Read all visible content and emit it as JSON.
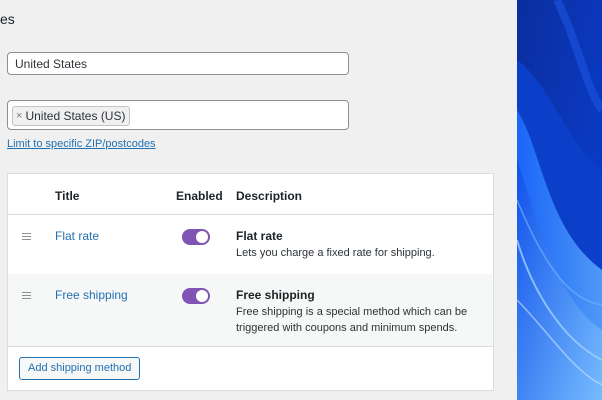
{
  "header": {
    "title_fragment": "es"
  },
  "zone": {
    "name_value": "United States",
    "regions": [
      {
        "label": "United States (US)",
        "remove_glyph": "×"
      }
    ],
    "zip_link": "Limit to specific ZIP/postcodes"
  },
  "methods_table": {
    "columns": {
      "title": "Title",
      "enabled": "Enabled",
      "description": "Description"
    },
    "rows": [
      {
        "title": "Flat rate",
        "enabled": true,
        "desc_title": "Flat rate",
        "desc_text": "Lets you charge a fixed rate for shipping."
      },
      {
        "title": "Free shipping",
        "enabled": true,
        "desc_title": "Free shipping",
        "desc_text": "Free shipping is a special method which can be triggered with coupons and minimum spends."
      }
    ],
    "add_button": "Add shipping method"
  },
  "colors": {
    "link": "#2271b1",
    "toggle_on": "#7f54b3",
    "wallpaper": "#0a35b8"
  }
}
